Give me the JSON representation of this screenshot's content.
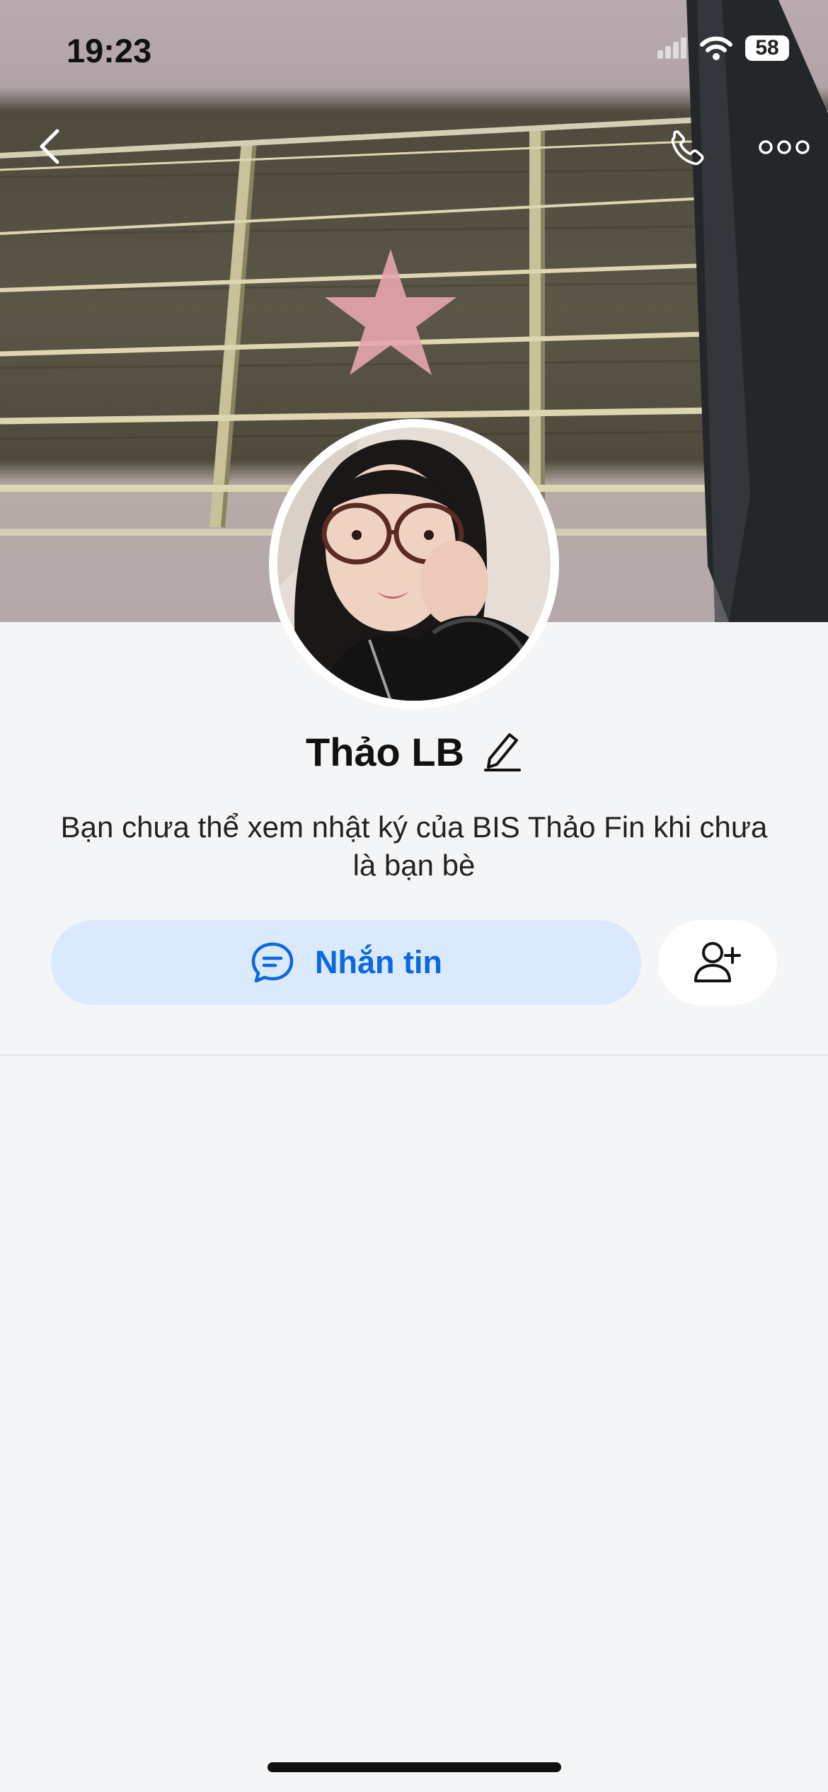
{
  "status_bar": {
    "time": "19:23",
    "battery": "58"
  },
  "profile": {
    "name": "Thảo LB",
    "privacy_note": "Bạn chưa thể xem nhật ký của BIS Thảo Fin khi chưa là bạn bè"
  },
  "actions": {
    "message_label": "Nhắn tin"
  },
  "colors": {
    "accent": "#0a68e0",
    "message_button_bg": "#dbe9fd",
    "background": "#f4f5f7"
  },
  "icons": [
    "back-icon",
    "phone-icon",
    "more-icon",
    "edit-icon",
    "chat-icon",
    "add-friend-icon",
    "wifi-icon",
    "cellular-icon",
    "battery-icon"
  ]
}
